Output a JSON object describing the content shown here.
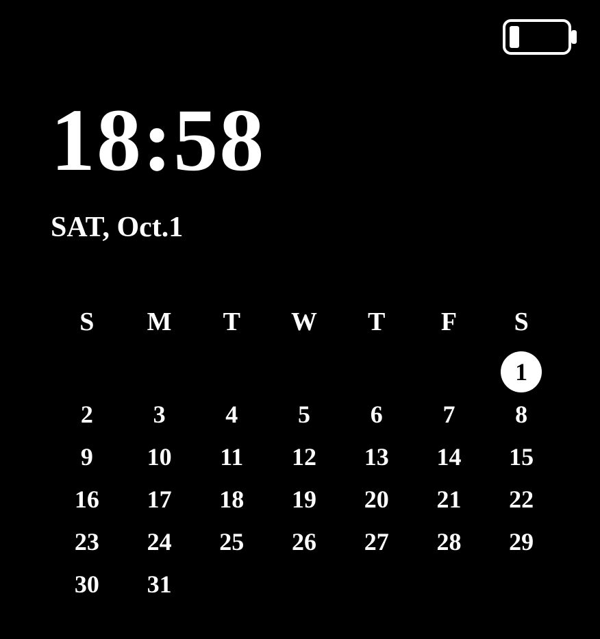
{
  "status": {
    "battery_level_pct": 15
  },
  "clock": {
    "time": "18:58",
    "date": "SAT, Oct.1"
  },
  "calendar": {
    "weekdays": [
      "S",
      "M",
      "T",
      "W",
      "T",
      "F",
      "S"
    ],
    "today": 1,
    "weeks": [
      [
        "",
        "",
        "",
        "",
        "",
        "",
        "1"
      ],
      [
        "2",
        "3",
        "4",
        "5",
        "6",
        "7",
        "8"
      ],
      [
        "9",
        "10",
        "11",
        "12",
        "13",
        "14",
        "15"
      ],
      [
        "16",
        "17",
        "18",
        "19",
        "20",
        "21",
        "22"
      ],
      [
        "23",
        "24",
        "25",
        "26",
        "27",
        "28",
        "29"
      ],
      [
        "30",
        "31",
        "",
        "",
        "",
        "",
        ""
      ]
    ]
  }
}
